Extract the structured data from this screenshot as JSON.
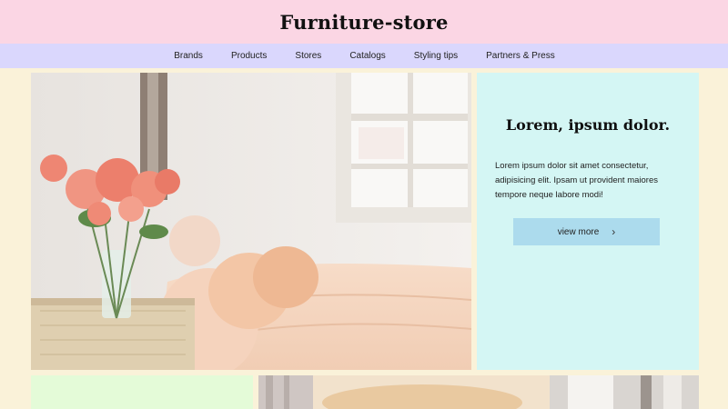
{
  "header": {
    "title": "Furniture-store"
  },
  "nav": {
    "items": [
      "Brands",
      "Products",
      "Stores",
      "Catalogs",
      "Styling tips",
      "Partners & Press"
    ]
  },
  "feature": {
    "title": "Lorem, ipsum dolor.",
    "body": "Lorem ipsum dolor sit amet consectetur, adipisicing elit. Ipsam ut provident maiores tempore neque labore modi!",
    "button_label": "view more"
  },
  "colors": {
    "page_bg": "#faf2d9",
    "header_bg": "#fbd6e4",
    "nav_bg": "#dad7fd",
    "panel_bg": "#d4f6f4",
    "button_bg": "#acdbed",
    "bottom_panel_bg": "#e4fbd8"
  },
  "icons": {
    "button_icon": "chevron-right-icon"
  }
}
